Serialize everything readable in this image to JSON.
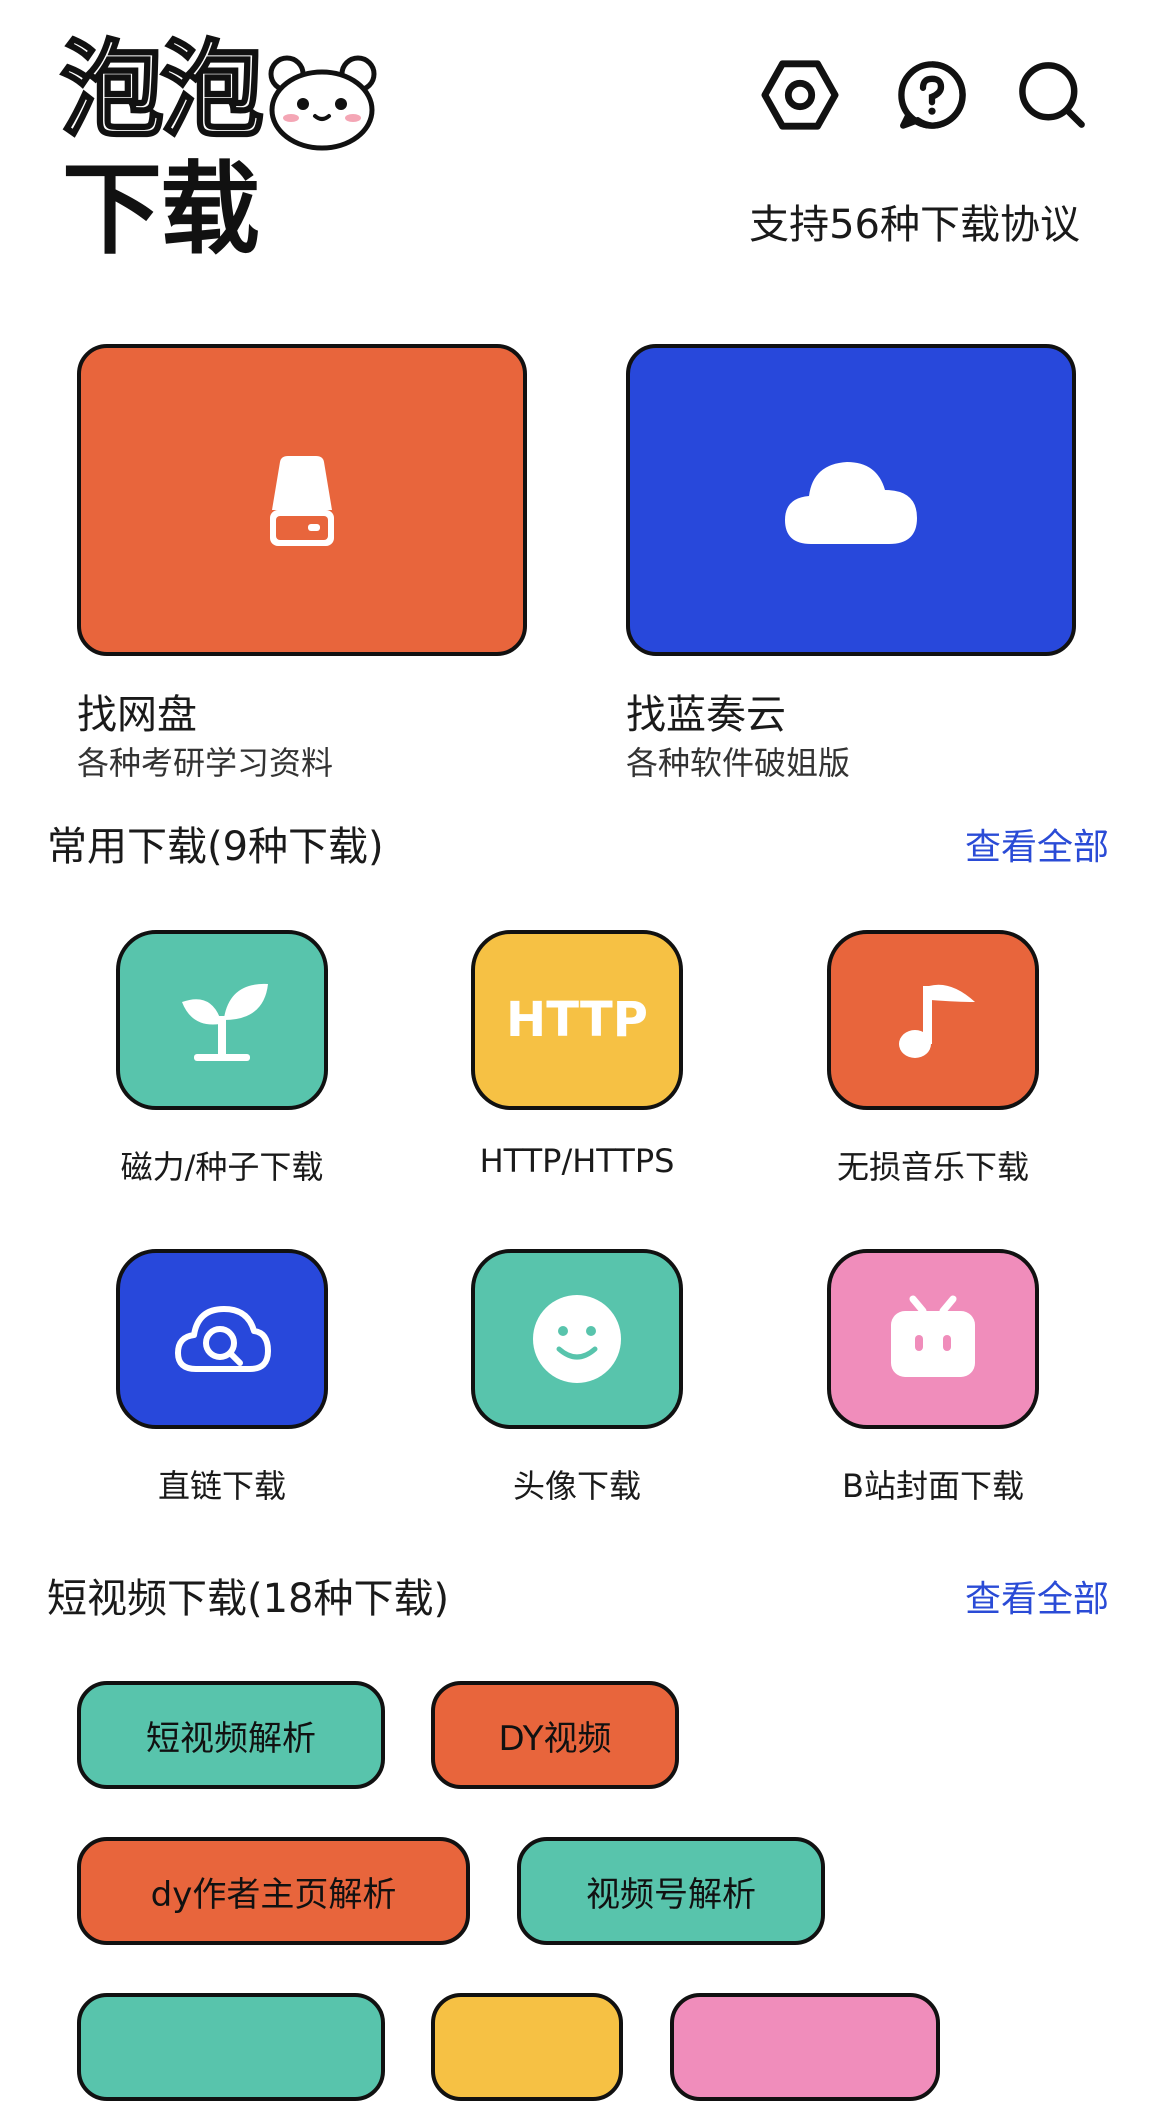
{
  "header": {
    "logo_line1": "泡泡",
    "logo_line2": "下载",
    "tagline": "支持56种下载协议",
    "icons": [
      "settings-icon",
      "help-icon",
      "search-icon"
    ]
  },
  "features": [
    {
      "title": "找网盘",
      "subtitle": "各种考研学习资料",
      "icon": "hard-drive-icon",
      "color": "#e8653c"
    },
    {
      "title": "找蓝奏云",
      "subtitle": "各种软件破姐版",
      "icon": "cloud-icon",
      "color": "#2848db"
    }
  ],
  "common_section": {
    "title": "常用下载(9种下载)",
    "view_all": "查看全部",
    "items": [
      {
        "label": "磁力/种子下载",
        "icon": "sprout-icon",
        "color": "#58c4ac"
      },
      {
        "label": "HTTP/HTTPS",
        "icon_text": "HTTP",
        "icon": "http-icon",
        "color": "#f6c144"
      },
      {
        "label": "无损音乐下载",
        "icon": "music-note-icon",
        "color": "#e8653c"
      },
      {
        "label": "直链下载",
        "icon": "cloud-search-icon",
        "color": "#2848db"
      },
      {
        "label": "头像下载",
        "icon": "smiley-icon",
        "color": "#58c4ac"
      },
      {
        "label": "B站封面下载",
        "icon": "bilibili-tv-icon",
        "color": "#f08dbb"
      }
    ]
  },
  "short_video_section": {
    "title": "短视频下载(18种下载)",
    "view_all": "查看全部",
    "chips": [
      {
        "label": "短视频解析",
        "color": "#58c4ac"
      },
      {
        "label": "DY视频",
        "color": "#e8653c"
      },
      {
        "label": "dy作者主页解析",
        "color": "#e8653c"
      },
      {
        "label": "视频号解析",
        "color": "#58c4ac"
      },
      {
        "label": "",
        "color": "#58c4ac"
      },
      {
        "label": "",
        "color": "#f6c144"
      },
      {
        "label": "",
        "color": "#f08dbb"
      }
    ]
  }
}
